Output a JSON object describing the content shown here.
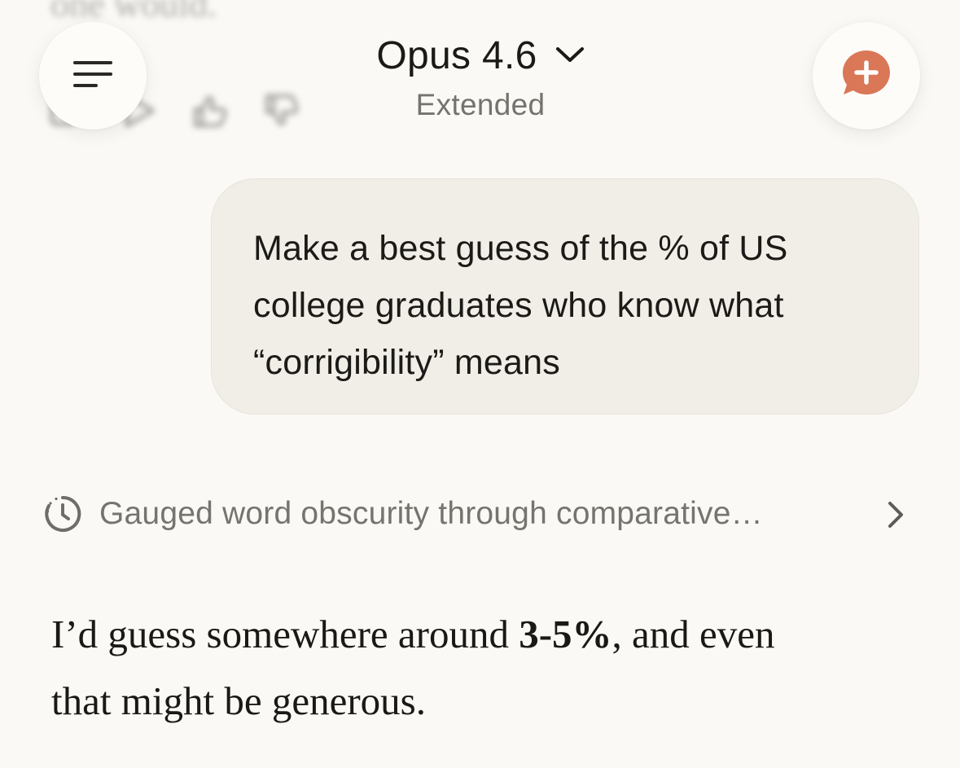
{
  "ghost": {
    "partial_text": "one would."
  },
  "header": {
    "model_name": "Opus 4.6",
    "model_mode": "Extended",
    "menu_icon": "menu-lines-icon",
    "new_chat_icon": "new-chat-plus-icon",
    "accent_color": "#d97757"
  },
  "user_message": {
    "line1": "Make a best guess of the % of US",
    "line2": "college graduates who know what",
    "line3": "“corrigibility” means"
  },
  "thinking": {
    "summary": "Gauged word obscurity through comparative…",
    "icon": "timer-icon"
  },
  "assistant_message": {
    "before": "I’d guess somewhere around ",
    "highlight": "3-5%",
    "after_line1": ", and even",
    "line2": "that might be generous."
  }
}
